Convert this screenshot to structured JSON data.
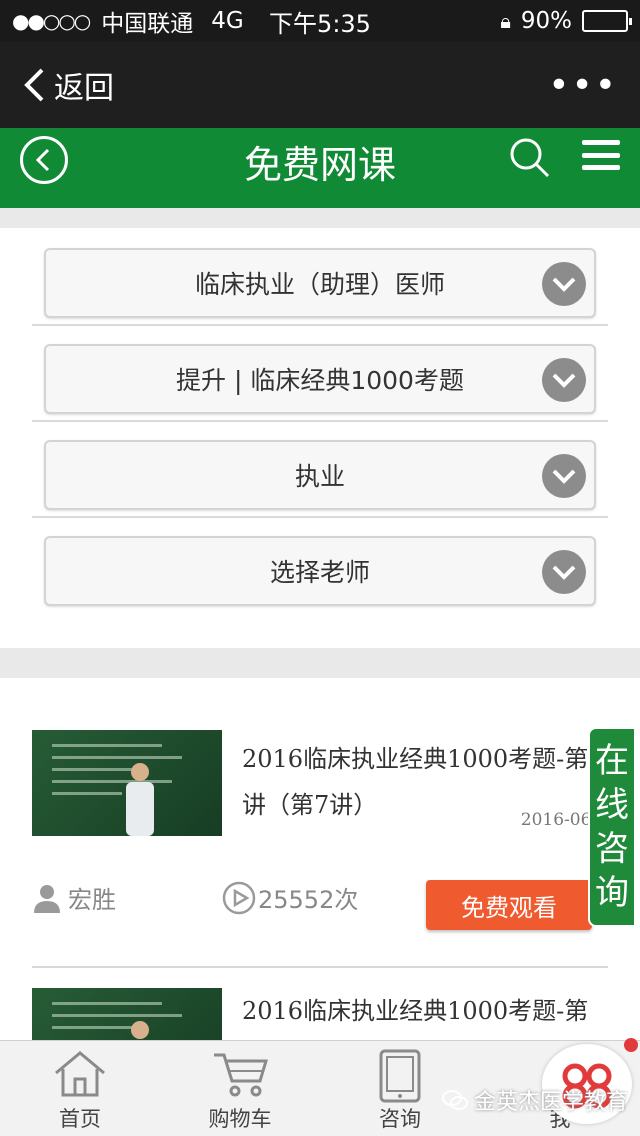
{
  "status_bar": {
    "signal": "●●○○○",
    "carrier": "中国联通",
    "network": "4G",
    "time": "下午5:35",
    "battery": "90%",
    "battery_level": 0.9
  },
  "wechat_nav": {
    "back_label": "返回",
    "more_label": "•••"
  },
  "header": {
    "title": "免费网课"
  },
  "filters": [
    {
      "label": "临床执业（助理）医师"
    },
    {
      "label": "提升 | 临床经典1000考题"
    },
    {
      "label": "执业"
    },
    {
      "label": "选择老师"
    }
  ],
  "courses": [
    {
      "title": "2016临床执业经典1000考题-第7讲（第7讲）",
      "date": "2016-06-1",
      "teacher": "宏胜",
      "views": "25552次",
      "watch_label": "免费观看"
    },
    {
      "title": "2016临床执业经典1000考题-第"
    }
  ],
  "consult": {
    "label": "在线咨询"
  },
  "tabbar": {
    "items": [
      {
        "label": "首页",
        "icon": "home-icon"
      },
      {
        "label": "购物车",
        "icon": "cart-icon"
      },
      {
        "label": "咨询",
        "icon": "tablet-icon"
      },
      {
        "label": "我",
        "icon": "user-icon"
      }
    ]
  },
  "watermark": "金英杰医学教育",
  "colors": {
    "brand_green": "#118a35",
    "watch_orange": "#ef5a2f",
    "status_dark": "#1a1a1a"
  }
}
